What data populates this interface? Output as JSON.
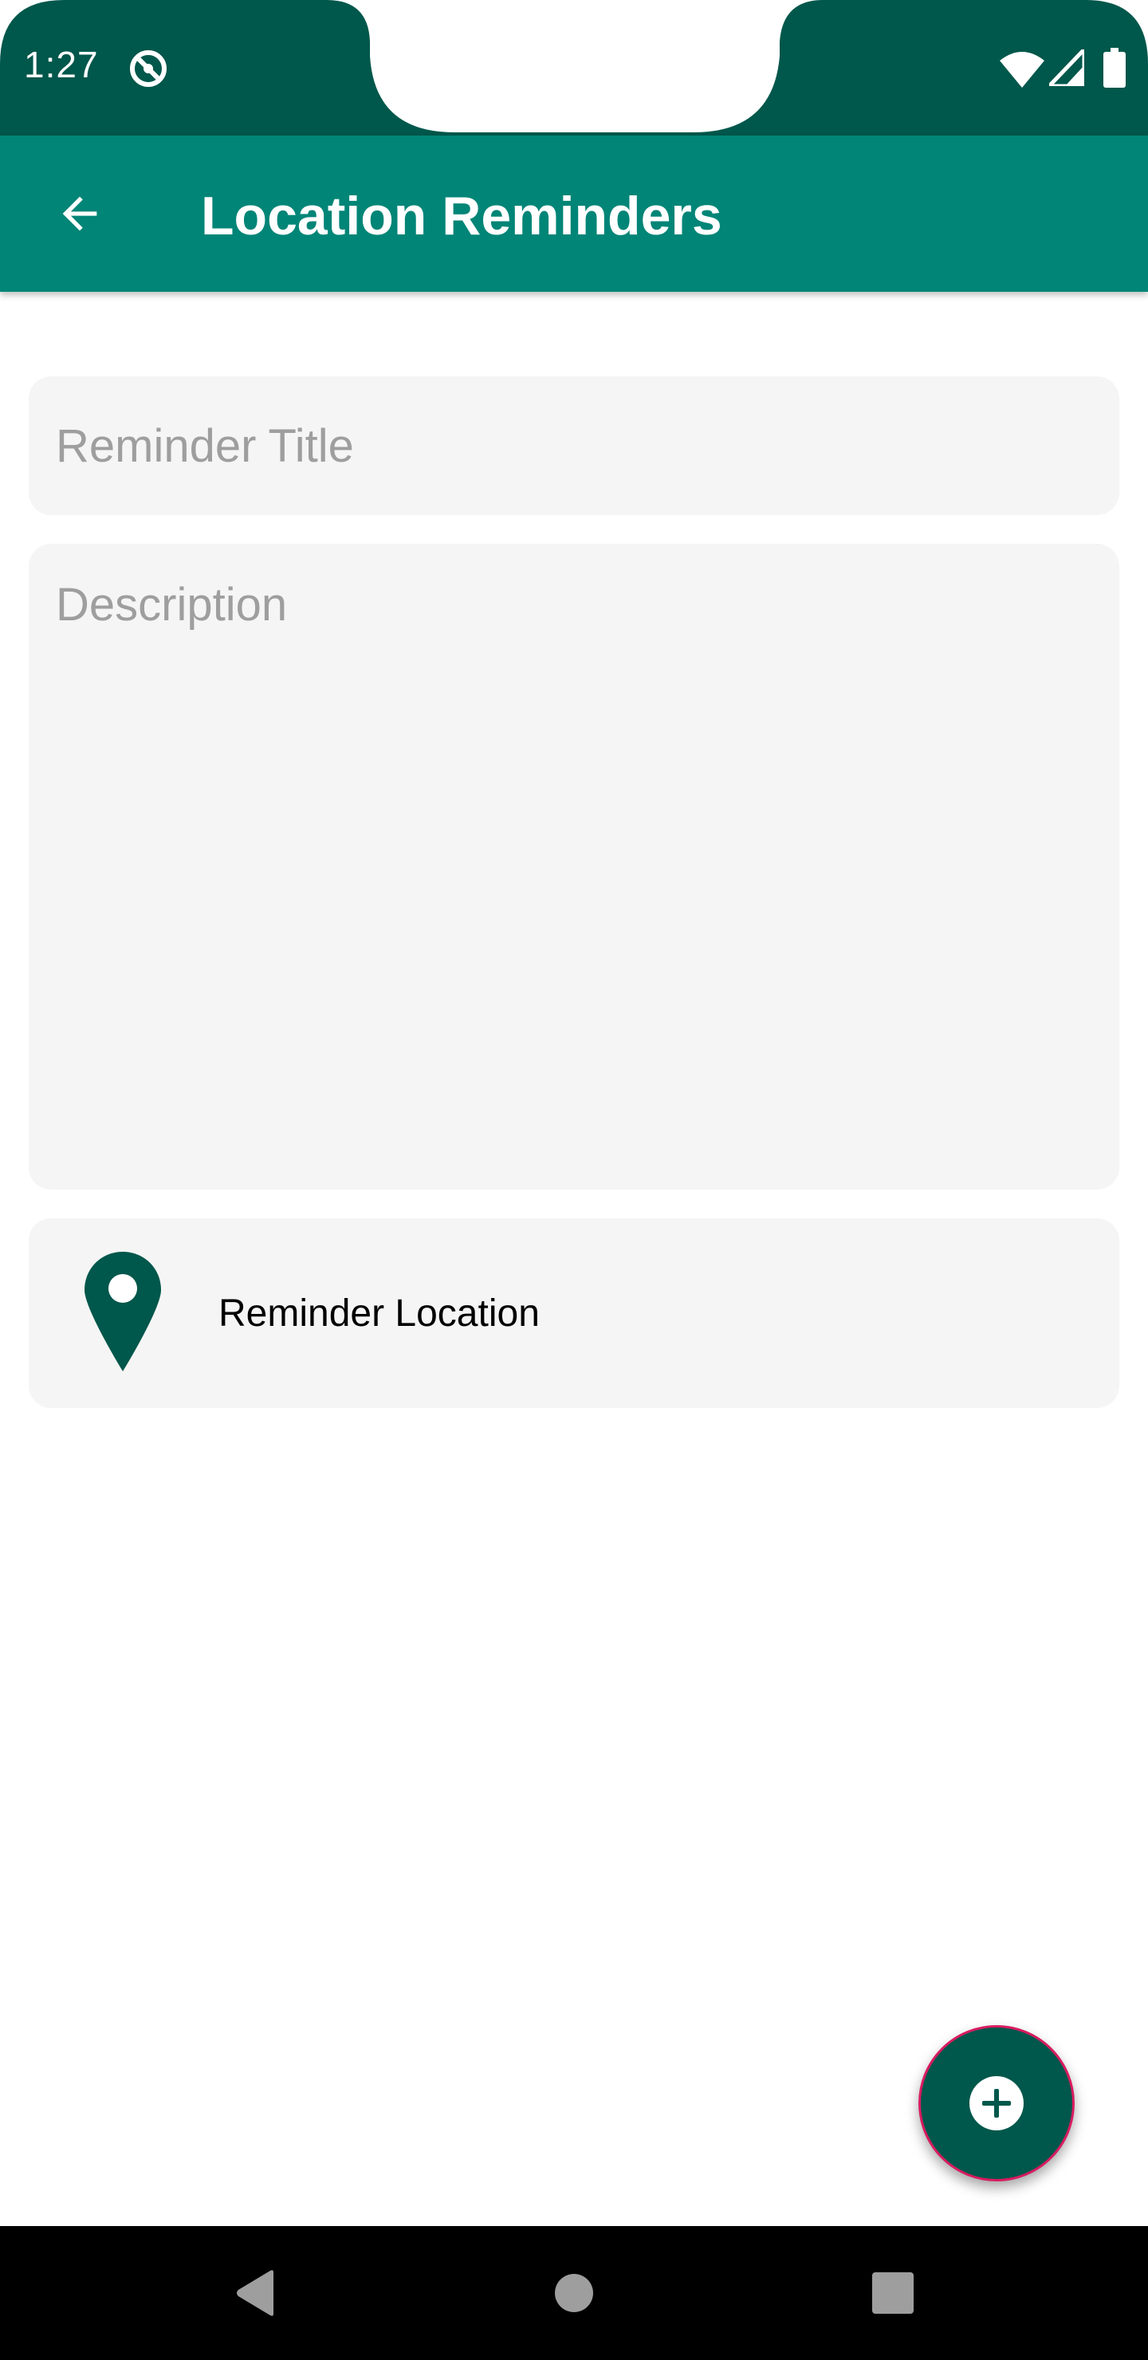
{
  "colors": {
    "status_bar": "#00574b",
    "app_bar": "#008577",
    "accent_dark": "#00574b",
    "fab_border": "#d81b60",
    "field_background": "#f5f5f5",
    "placeholder": "#9e9e9e",
    "nav_bar": "#000000",
    "nav_icons": "#9e9e9e"
  },
  "status_bar": {
    "time": "1:27",
    "icons": [
      "notification-icon",
      "wifi-icon",
      "cell-signal-icon",
      "battery-icon"
    ]
  },
  "app_bar": {
    "title": "Location Reminders",
    "back_icon": "arrow-back-icon"
  },
  "form": {
    "title_field": {
      "value": "",
      "placeholder": "Reminder Title"
    },
    "description_field": {
      "value": "",
      "placeholder": "Description"
    },
    "location": {
      "icon": "map-pin-icon",
      "label": "Reminder Location"
    }
  },
  "fab": {
    "icon": "add-circle-icon"
  },
  "nav_bar": {
    "icons": [
      "nav-back-icon",
      "nav-home-icon",
      "nav-recents-icon"
    ]
  }
}
